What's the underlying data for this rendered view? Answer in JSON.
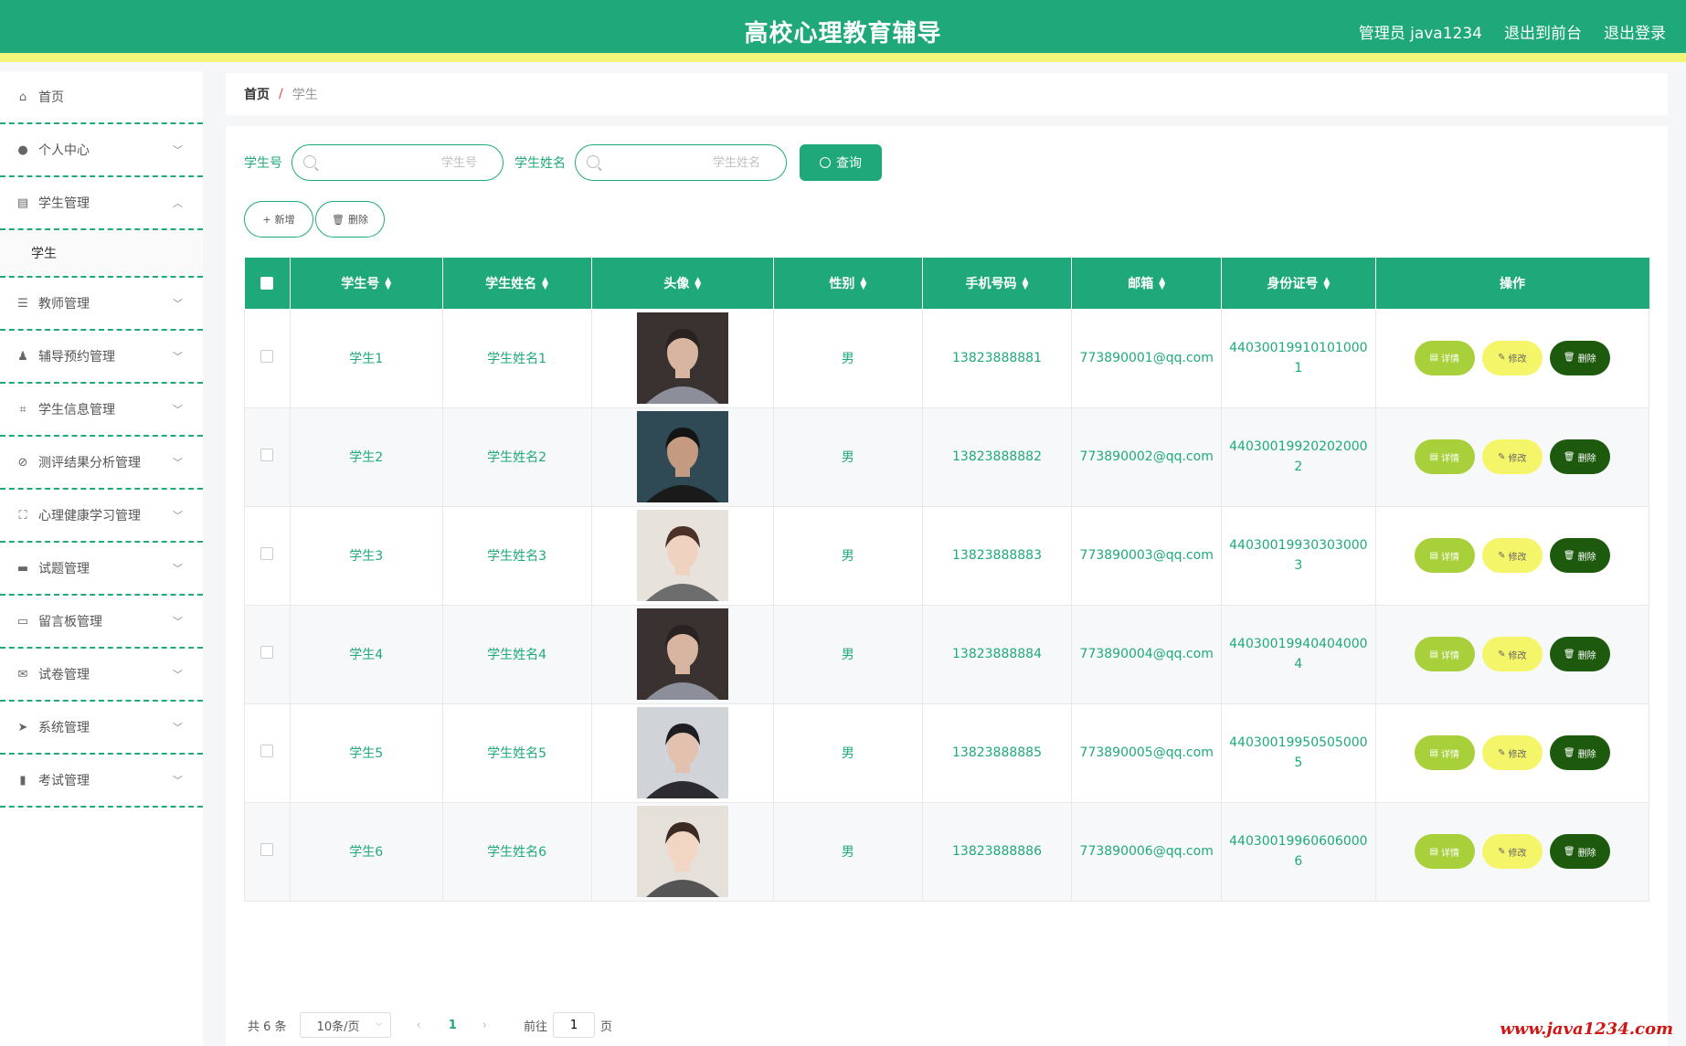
{
  "header": {
    "title": "高校心理教育辅导",
    "user": "管理员 java1234",
    "front": "退出到前台",
    "logout": "退出登录"
  },
  "sidebar": {
    "items": [
      {
        "label": "首页",
        "icon": "home-icon"
      },
      {
        "label": "个人中心",
        "icon": "user-icon"
      },
      {
        "label": "学生管理",
        "icon": "clipboard-icon",
        "expanded": true,
        "children": [
          {
            "label": "学生"
          }
        ]
      },
      {
        "label": "教师管理",
        "icon": "list-icon"
      },
      {
        "label": "辅导预约管理",
        "icon": "person-icon"
      },
      {
        "label": "学生信息管理",
        "icon": "crop-icon"
      },
      {
        "label": "测评结果分析管理",
        "icon": "bell-off-icon"
      },
      {
        "label": "心理健康学习管理",
        "icon": "fullscreen-icon"
      },
      {
        "label": "试题管理",
        "icon": "chat-icon"
      },
      {
        "label": "留言板管理",
        "icon": "printer-icon"
      },
      {
        "label": "试卷管理",
        "icon": "mail-icon"
      },
      {
        "label": "系统管理",
        "icon": "send-icon"
      },
      {
        "label": "考试管理",
        "icon": "bar-chart-icon"
      }
    ]
  },
  "breadcrumb": {
    "home": "首页",
    "sep": "/",
    "current": "学生"
  },
  "search": {
    "student_no_label": "学生号",
    "student_no_placeholder": "学生号",
    "student_name_label": "学生姓名",
    "student_name_placeholder": "学生姓名",
    "query": "查询"
  },
  "actions": {
    "add": "新增",
    "delete": "删除"
  },
  "table": {
    "headers": [
      "学生号",
      "学生姓名",
      "头像",
      "性别",
      "手机号码",
      "邮箱",
      "身份证号",
      "操作"
    ],
    "rows": [
      {
        "no": "学生1",
        "name": "学生姓名1",
        "gender": "男",
        "phone": "13823888881",
        "email": "773890001@qq.com",
        "id1": "44030019910101000",
        "id2": "1",
        "avatar": {
          "bg": "#3a3230",
          "skin": "#d8b5a0",
          "hair": "#2a2220",
          "shirt": "#8c8f9a"
        }
      },
      {
        "no": "学生2",
        "name": "学生姓名2",
        "gender": "男",
        "phone": "13823888882",
        "email": "773890002@qq.com",
        "id1": "44030019920202000",
        "id2": "2",
        "avatar": {
          "bg": "#2f4a55",
          "skin": "#c49a80",
          "hair": "#141414",
          "shirt": "#1a1a1a"
        }
      },
      {
        "no": "学生3",
        "name": "学生姓名3",
        "gender": "男",
        "phone": "13823888883",
        "email": "773890003@qq.com",
        "id1": "44030019930303000",
        "id2": "3",
        "avatar": {
          "bg": "#e8e2dc",
          "skin": "#f0d2c0",
          "hair": "#4a3228",
          "shirt": "#6d6d6d"
        }
      },
      {
        "no": "学生4",
        "name": "学生姓名4",
        "gender": "男",
        "phone": "13823888884",
        "email": "773890004@qq.com",
        "id1": "44030019940404000",
        "id2": "4",
        "avatar": {
          "bg": "#3a3230",
          "skin": "#d8b5a0",
          "hair": "#2a2220",
          "shirt": "#8c8f9a"
        }
      },
      {
        "no": "学生5",
        "name": "学生姓名5",
        "gender": "男",
        "phone": "13823888885",
        "email": "773890005@qq.com",
        "id1": "44030019950505000",
        "id2": "5",
        "avatar": {
          "bg": "#d0d4d8",
          "skin": "#e2c2ae",
          "hair": "#1e1e22",
          "shirt": "#2c2c30"
        }
      },
      {
        "no": "学生6",
        "name": "学生姓名6",
        "gender": "男",
        "phone": "13823888886",
        "email": "773890006@qq.com",
        "id1": "44030019960606000",
        "id2": "6",
        "avatar": {
          "bg": "#e6e0da",
          "skin": "#f2d6c4",
          "hair": "#3a2a22",
          "shirt": "#555555"
        }
      }
    ],
    "ops": {
      "detail": "详情",
      "edit": "修改",
      "delete": "删除"
    }
  },
  "pager": {
    "total": "共 6 条",
    "size": "10条/页",
    "current": "1",
    "goto": "前往",
    "page_input": "1",
    "page_unit": "页"
  },
  "watermark": "www.java1234.com",
  "colors": {
    "primary": "#1fa97a",
    "accent_bar": "#f1f57a",
    "detail": "#a8d03a",
    "edit": "#f5f56a",
    "delete": "#1e5a0e"
  }
}
